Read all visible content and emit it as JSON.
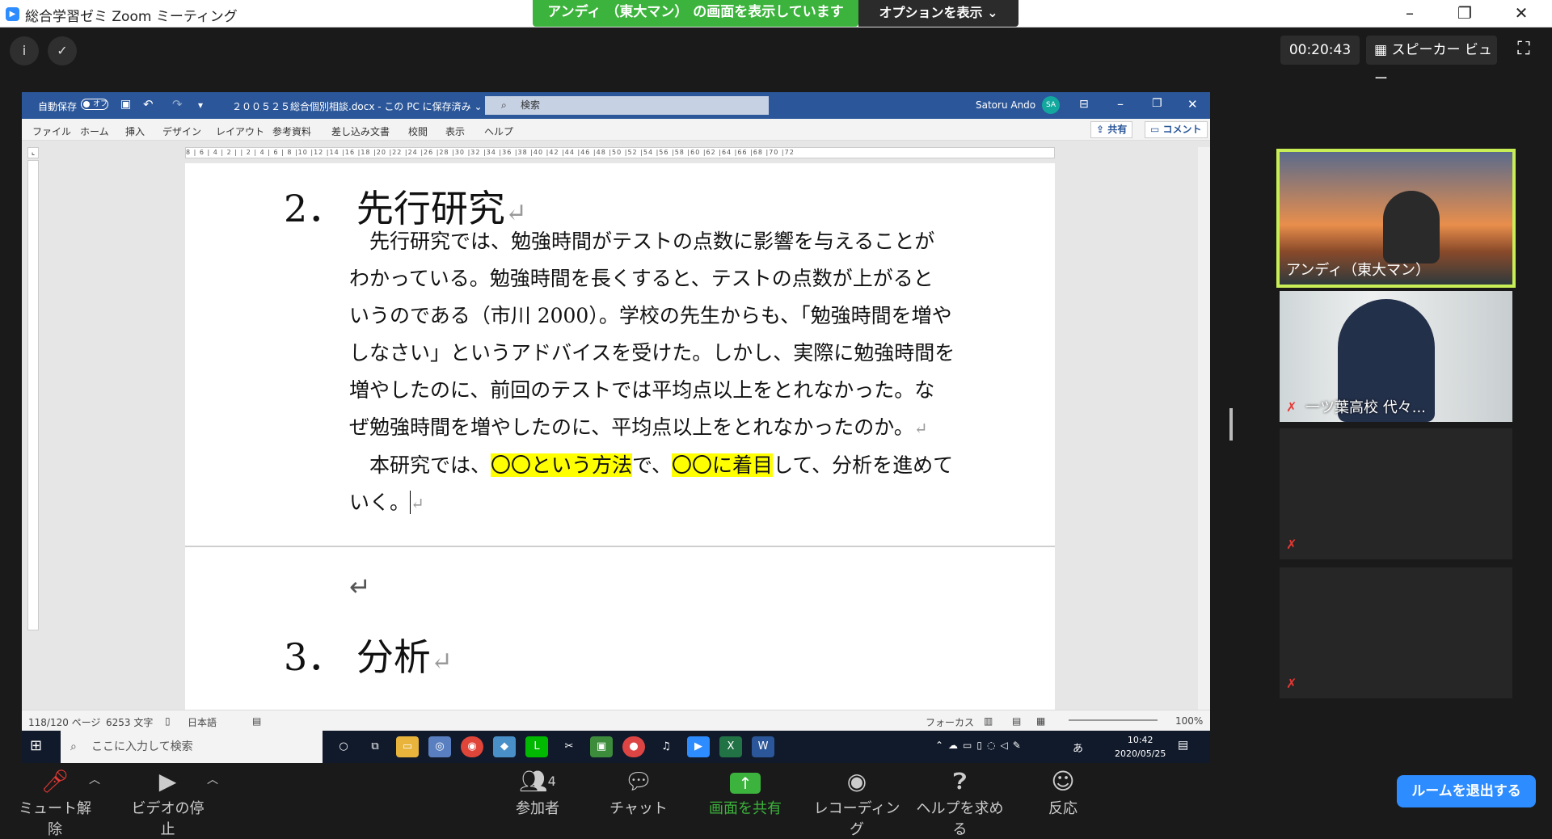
{
  "window": {
    "title": "総合学習ゼミ   Zoom ミーティング",
    "share_banner": "アンディ （東大マン） の画面を表示しています",
    "options": "オプションを表示 ⌄",
    "min": "–",
    "max": "❐",
    "close": "✕"
  },
  "topbar": {
    "info_icon": "i",
    "shield_icon": "✓",
    "timer": "00:20:43",
    "speaker_view": "スピーカー ビュー",
    "fullscreen_icon": "⛶"
  },
  "word": {
    "autosave": "自動保存",
    "autosave_toggle": "オフ",
    "doc_name": "２００５２５総合個別相談.docx - この PC に保存済み ⌄",
    "search_placeholder": "検索",
    "user": "Satoru Ando",
    "user_initials": "SA",
    "menu": [
      "ファイル",
      "ホーム",
      "挿入",
      "デザイン",
      "レイアウト",
      "参考資料",
      "差し込み文書",
      "校閲",
      "表示",
      "ヘルプ"
    ],
    "share_btn": "共有",
    "comment_btn": "コメント",
    "ruler": "8 | 6 | 4 | 2 |   | 2 | 4 | 6 | 8 |10 |12 |14 |16 |18 |20 |22 |24 |26 |28 |30 |32 |34 |36 |38 |40 |42 |44 |46 |48 |50 |52 |54 |56 |58 |60 |62 |64 |66 |68 |70 |72",
    "heading2": "2．  先行研究",
    "para1_lines": [
      "　先行研究では、勉強時間がテストの点数に影響を与えることが",
      "わかっている。勉強時間を長くすると、テストの点数が上がると",
      "いうのである（市川 2000）。学校の先生からも、「勉強時間を増や",
      "しなさい」というアドバイスを受けた。しかし、実際に勉強時間を",
      "増やしたのに、前回のテストでは平均点以上をとれなかった。な",
      "ぜ勉強時間を増やしたのに、平均点以上をとれなかったのか。"
    ],
    "para2_start": "　本研究では、",
    "para2_hl1": "〇〇という方法",
    "para2_mid": "で、",
    "para2_hl2": "〇〇に着目",
    "para2_end": "して、分析を進めて",
    "para2_line2": "いく。",
    "pilcrow": "↵",
    "heading3": "3．  分析",
    "status_page": "118/120 ページ",
    "status_words": "6253 文字",
    "status_lang": "日本語",
    "status_focus": "フォーカス",
    "status_zoom": "100%"
  },
  "taskbar": {
    "search": "ここに入力して検索",
    "time": "10:42",
    "date": "2020/05/25",
    "ime": "あ"
  },
  "participants": [
    {
      "name": "アンディ（東大マン）",
      "active": true
    },
    {
      "name": "一ツ葉高校 代々...",
      "muted": true
    },
    {
      "name": "",
      "muted": true
    },
    {
      "name": "",
      "muted": true
    }
  ],
  "toolbar": {
    "mute": "ミュート解除",
    "video": "ビデオの停止",
    "participants": "参加者",
    "participants_count": "4",
    "chat": "チャット",
    "share": "画面を共有",
    "record": "レコーディング",
    "help": "ヘルプを求める",
    "react": "反応",
    "leave": "ルームを退出する"
  },
  "colors": {
    "zoom_blue": "#2d8cff",
    "share_green": "#3cb33c",
    "word_blue": "#2b579a",
    "active_speaker": "#c8ee55",
    "highlight": "#ffff00"
  }
}
